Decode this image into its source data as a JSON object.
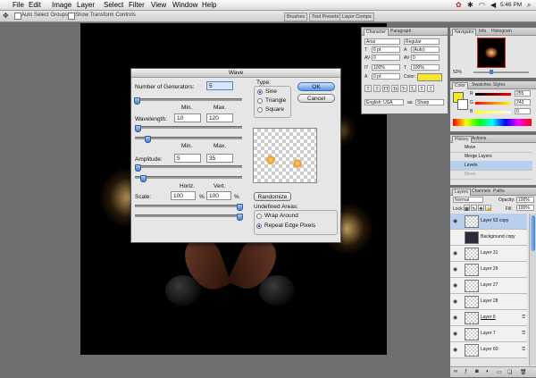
{
  "menubar": {
    "apple": "",
    "items": [
      "File",
      "Edit",
      "Image",
      "Layer",
      "Select",
      "Filter",
      "View",
      "Window",
      "Help"
    ],
    "time": "5:46 PM"
  },
  "options": {
    "auto_select": "Auto Select Groups",
    "show_transform": "Show Transform Controls",
    "tabs": [
      "Brushes",
      "Tool Presets",
      "Layer Comps"
    ]
  },
  "wave": {
    "title": "Wave",
    "generators_label": "Number of Generators:",
    "generators_value": "5",
    "min_label": "Min.",
    "max_label": "Max.",
    "wavelength_label": "Wavelength:",
    "wavelength_min": "10",
    "wavelength_max": "120",
    "amplitude_label": "Amplitude:",
    "amplitude_min": "5",
    "amplitude_max": "35",
    "horiz_label": "Horiz.",
    "vert_label": "Vert.",
    "scale_label": "Scale:",
    "scale_h": "100",
    "scale_v": "100",
    "percent": "%",
    "type_label": "Type:",
    "type_sine": "Sine",
    "type_triangle": "Triangle",
    "type_square": "Square",
    "ok": "OK",
    "cancel": "Cancel",
    "randomize": "Randomize",
    "undefined_label": "Undefined Areas:",
    "wrap_around": "Wrap Around",
    "repeat_edge": "Repeat Edge Pixels"
  },
  "character": {
    "tabs": [
      "Character",
      "Paragraph"
    ],
    "font": "Arial",
    "style": "Regular",
    "size": "6 pt",
    "leading": "(Auto)",
    "kerning": "0",
    "tracking": "0",
    "vscale": "100%",
    "hscale": "100%",
    "baseline": "0 pt",
    "color_label": "Color:",
    "color_value": "#f5e62a",
    "styles": [
      "T",
      "T",
      "TT",
      "Tt",
      "T¹",
      "T₁",
      "T",
      "T"
    ],
    "language": "English: USA",
    "aa_label": "aa",
    "aa": "Sharp"
  },
  "navigator": {
    "tabs": [
      "Navigator",
      "Info",
      "Histogram"
    ],
    "zoom": "50%"
  },
  "color": {
    "tabs": [
      "Color",
      "Swatches",
      "Styles"
    ],
    "r_label": "R",
    "g_label": "G",
    "b_label": "B",
    "r": "255",
    "g": "243",
    "b": "0"
  },
  "history": {
    "tabs": [
      "History",
      "Actions"
    ],
    "items": [
      "Move",
      "Merge Layers",
      "Levels",
      "Move"
    ]
  },
  "layers": {
    "tabs": [
      "Layers",
      "Channels",
      "Paths"
    ],
    "blend": "Normal",
    "opacity_label": "Opacity:",
    "opacity": "100%",
    "lock_label": "Lock:",
    "fill_label": "Fill:",
    "fill": "100%",
    "rows": [
      {
        "name": "Layer 63 copy",
        "selected": true
      },
      {
        "name": "Background copy",
        "selected": false
      },
      {
        "name": "Layer 31",
        "selected": false
      },
      {
        "name": "Layer 29",
        "selected": false
      },
      {
        "name": "Layer 27",
        "selected": false
      },
      {
        "name": "Layer 28",
        "selected": false
      },
      {
        "name": "Layer 6",
        "selected": false
      },
      {
        "name": "Layer 7",
        "selected": false
      },
      {
        "name": "Layer 60",
        "selected": false
      }
    ]
  }
}
